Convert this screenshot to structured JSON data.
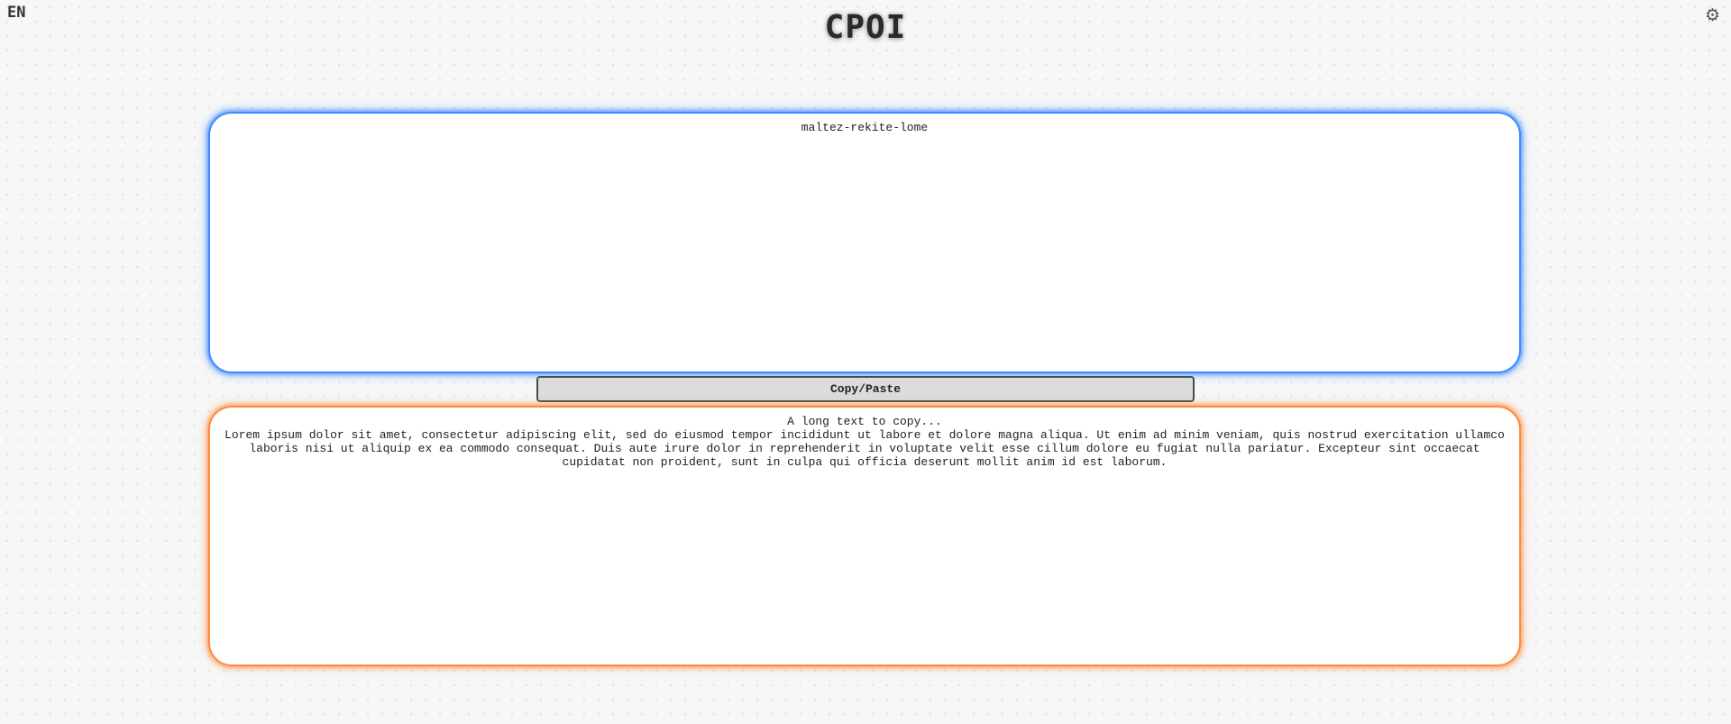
{
  "header": {
    "language": "EN",
    "logo": "CPOI",
    "settings_icon": "gear-icon"
  },
  "top_box": {
    "content": "maltez-rekite-lome",
    "accent_color": "#3d8bff"
  },
  "action": {
    "label": "Copy/Paste"
  },
  "bottom_box": {
    "content": "A long text to copy...\nLorem ipsum dolor sit amet, consectetur adipiscing elit, sed do eiusmod tempor incididunt ut labore et dolore magna aliqua. Ut enim ad minim veniam, quis nostrud exercitation ullamco laboris nisi ut aliquip ex ea commodo consequat. Duis aute irure dolor in reprehenderit in voluptate velit esse cillum dolore eu fugiat nulla pariatur. Excepteur sint occaecat cupidatat non proident, sunt in culpa qui officia deserunt mollit anim id est laborum.",
    "accent_color": "#ff8a3d"
  }
}
